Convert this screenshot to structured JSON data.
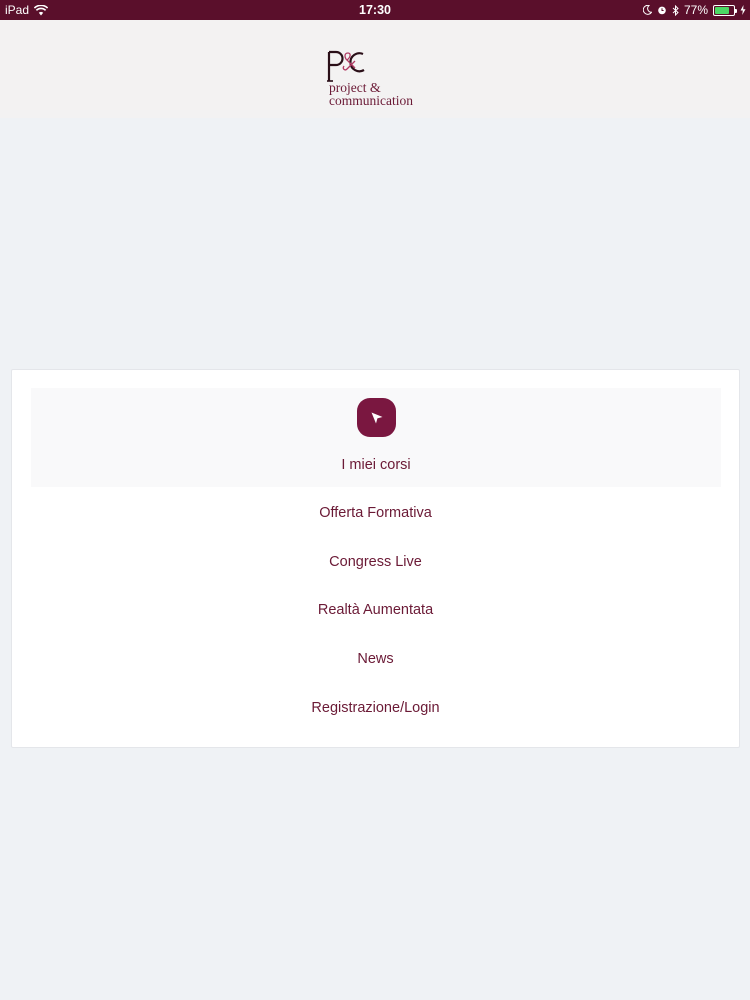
{
  "status_bar": {
    "device": "iPad",
    "time": "17:30",
    "battery_percent": "77%",
    "battery_level": 0.77,
    "icons": [
      "wifi-icon",
      "moon-icon",
      "alarm-icon",
      "bluetooth-icon",
      "battery-icon",
      "charging-icon"
    ]
  },
  "header": {
    "logo_line1": "project",
    "logo_line2": "communication"
  },
  "menu": {
    "items": [
      {
        "label": "I miei corsi",
        "icon": "cursor-arrow-icon",
        "active": true
      },
      {
        "label": "Offerta Formativa"
      },
      {
        "label": "Congress Live"
      },
      {
        "label": "Realtà Aumentata"
      },
      {
        "label": "News"
      },
      {
        "label": "Registrazione/Login"
      }
    ]
  },
  "colors": {
    "brand": "#6b1a36",
    "status_bar": "#5a0f2b",
    "icon_bg": "#7a1740",
    "background": "#eff2f5"
  }
}
